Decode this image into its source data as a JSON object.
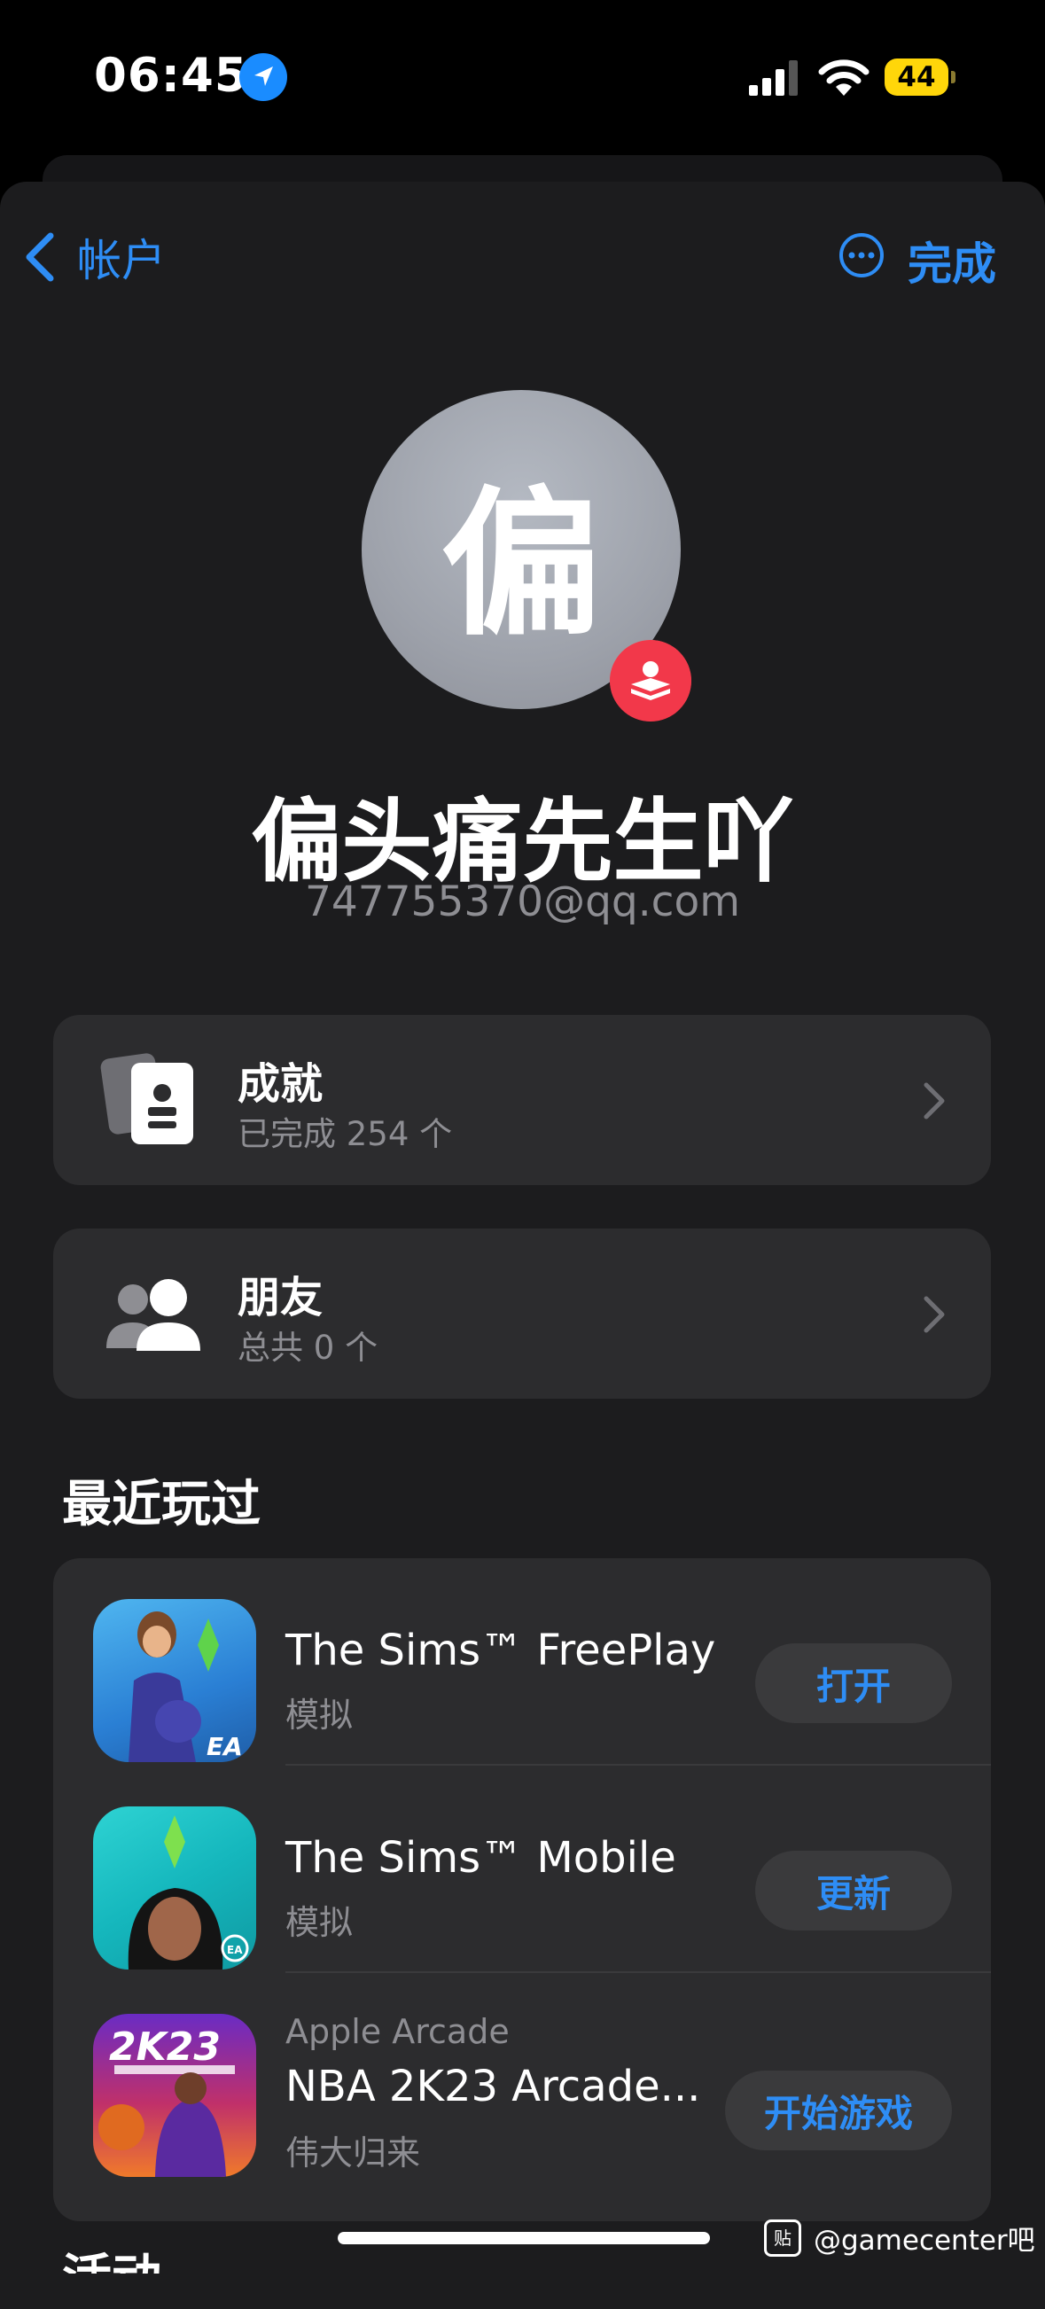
{
  "status_bar": {
    "time": "06:45",
    "battery": "44"
  },
  "nav": {
    "back_label": "帐户",
    "done_label": "完成"
  },
  "profile": {
    "avatar_char": "偏",
    "display_name": "偏头痛先生吖",
    "email": "747755370@qq.com"
  },
  "cards": [
    {
      "title": "成就",
      "subtitle": "已完成 254 个"
    },
    {
      "title": "朋友",
      "subtitle": "总共 0 个"
    }
  ],
  "recent": {
    "title": "最近玩过",
    "games": [
      {
        "pre": "",
        "name": "The Sims™ FreePlay",
        "genre": "模拟",
        "button": "打开"
      },
      {
        "pre": "",
        "name": "The Sims™ Mobile",
        "genre": "模拟",
        "button": "更新"
      },
      {
        "pre": "Apple Arcade",
        "name": "NBA 2K23 Arcade...",
        "genre": "伟大归来",
        "button": "开始游戏"
      }
    ]
  },
  "activity_title": "活动",
  "watermark": "@gamecenter吧",
  "colors": {
    "accent": "#2e8df5",
    "sheet": "#1c1c1e",
    "card": "#2c2c2e",
    "battery": "#ffd60a"
  }
}
